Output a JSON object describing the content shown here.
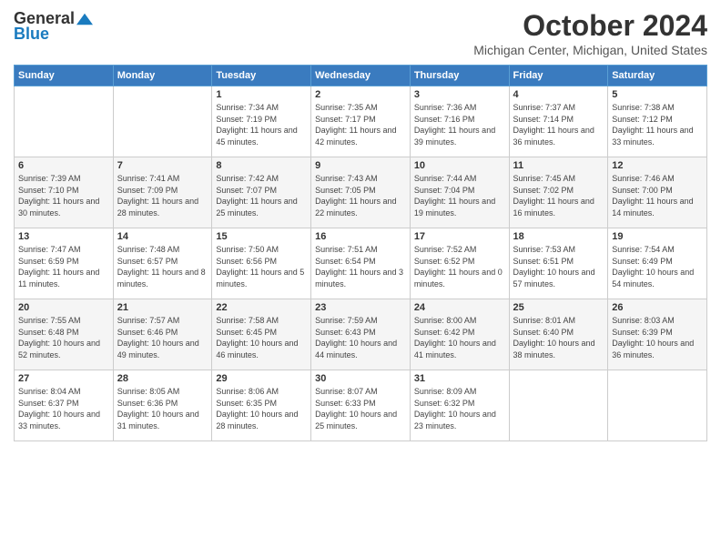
{
  "header": {
    "logo_general": "General",
    "logo_blue": "Blue",
    "month_title": "October 2024",
    "location": "Michigan Center, Michigan, United States"
  },
  "days_of_week": [
    "Sunday",
    "Monday",
    "Tuesday",
    "Wednesday",
    "Thursday",
    "Friday",
    "Saturday"
  ],
  "weeks": [
    [
      {
        "day": "",
        "sunrise": "",
        "sunset": "",
        "daylight": ""
      },
      {
        "day": "",
        "sunrise": "",
        "sunset": "",
        "daylight": ""
      },
      {
        "day": "1",
        "sunrise": "Sunrise: 7:34 AM",
        "sunset": "Sunset: 7:19 PM",
        "daylight": "Daylight: 11 hours and 45 minutes."
      },
      {
        "day": "2",
        "sunrise": "Sunrise: 7:35 AM",
        "sunset": "Sunset: 7:17 PM",
        "daylight": "Daylight: 11 hours and 42 minutes."
      },
      {
        "day": "3",
        "sunrise": "Sunrise: 7:36 AM",
        "sunset": "Sunset: 7:16 PM",
        "daylight": "Daylight: 11 hours and 39 minutes."
      },
      {
        "day": "4",
        "sunrise": "Sunrise: 7:37 AM",
        "sunset": "Sunset: 7:14 PM",
        "daylight": "Daylight: 11 hours and 36 minutes."
      },
      {
        "day": "5",
        "sunrise": "Sunrise: 7:38 AM",
        "sunset": "Sunset: 7:12 PM",
        "daylight": "Daylight: 11 hours and 33 minutes."
      }
    ],
    [
      {
        "day": "6",
        "sunrise": "Sunrise: 7:39 AM",
        "sunset": "Sunset: 7:10 PM",
        "daylight": "Daylight: 11 hours and 30 minutes."
      },
      {
        "day": "7",
        "sunrise": "Sunrise: 7:41 AM",
        "sunset": "Sunset: 7:09 PM",
        "daylight": "Daylight: 11 hours and 28 minutes."
      },
      {
        "day": "8",
        "sunrise": "Sunrise: 7:42 AM",
        "sunset": "Sunset: 7:07 PM",
        "daylight": "Daylight: 11 hours and 25 minutes."
      },
      {
        "day": "9",
        "sunrise": "Sunrise: 7:43 AM",
        "sunset": "Sunset: 7:05 PM",
        "daylight": "Daylight: 11 hours and 22 minutes."
      },
      {
        "day": "10",
        "sunrise": "Sunrise: 7:44 AM",
        "sunset": "Sunset: 7:04 PM",
        "daylight": "Daylight: 11 hours and 19 minutes."
      },
      {
        "day": "11",
        "sunrise": "Sunrise: 7:45 AM",
        "sunset": "Sunset: 7:02 PM",
        "daylight": "Daylight: 11 hours and 16 minutes."
      },
      {
        "day": "12",
        "sunrise": "Sunrise: 7:46 AM",
        "sunset": "Sunset: 7:00 PM",
        "daylight": "Daylight: 11 hours and 14 minutes."
      }
    ],
    [
      {
        "day": "13",
        "sunrise": "Sunrise: 7:47 AM",
        "sunset": "Sunset: 6:59 PM",
        "daylight": "Daylight: 11 hours and 11 minutes."
      },
      {
        "day": "14",
        "sunrise": "Sunrise: 7:48 AM",
        "sunset": "Sunset: 6:57 PM",
        "daylight": "Daylight: 11 hours and 8 minutes."
      },
      {
        "day": "15",
        "sunrise": "Sunrise: 7:50 AM",
        "sunset": "Sunset: 6:56 PM",
        "daylight": "Daylight: 11 hours and 5 minutes."
      },
      {
        "day": "16",
        "sunrise": "Sunrise: 7:51 AM",
        "sunset": "Sunset: 6:54 PM",
        "daylight": "Daylight: 11 hours and 3 minutes."
      },
      {
        "day": "17",
        "sunrise": "Sunrise: 7:52 AM",
        "sunset": "Sunset: 6:52 PM",
        "daylight": "Daylight: 11 hours and 0 minutes."
      },
      {
        "day": "18",
        "sunrise": "Sunrise: 7:53 AM",
        "sunset": "Sunset: 6:51 PM",
        "daylight": "Daylight: 10 hours and 57 minutes."
      },
      {
        "day": "19",
        "sunrise": "Sunrise: 7:54 AM",
        "sunset": "Sunset: 6:49 PM",
        "daylight": "Daylight: 10 hours and 54 minutes."
      }
    ],
    [
      {
        "day": "20",
        "sunrise": "Sunrise: 7:55 AM",
        "sunset": "Sunset: 6:48 PM",
        "daylight": "Daylight: 10 hours and 52 minutes."
      },
      {
        "day": "21",
        "sunrise": "Sunrise: 7:57 AM",
        "sunset": "Sunset: 6:46 PM",
        "daylight": "Daylight: 10 hours and 49 minutes."
      },
      {
        "day": "22",
        "sunrise": "Sunrise: 7:58 AM",
        "sunset": "Sunset: 6:45 PM",
        "daylight": "Daylight: 10 hours and 46 minutes."
      },
      {
        "day": "23",
        "sunrise": "Sunrise: 7:59 AM",
        "sunset": "Sunset: 6:43 PM",
        "daylight": "Daylight: 10 hours and 44 minutes."
      },
      {
        "day": "24",
        "sunrise": "Sunrise: 8:00 AM",
        "sunset": "Sunset: 6:42 PM",
        "daylight": "Daylight: 10 hours and 41 minutes."
      },
      {
        "day": "25",
        "sunrise": "Sunrise: 8:01 AM",
        "sunset": "Sunset: 6:40 PM",
        "daylight": "Daylight: 10 hours and 38 minutes."
      },
      {
        "day": "26",
        "sunrise": "Sunrise: 8:03 AM",
        "sunset": "Sunset: 6:39 PM",
        "daylight": "Daylight: 10 hours and 36 minutes."
      }
    ],
    [
      {
        "day": "27",
        "sunrise": "Sunrise: 8:04 AM",
        "sunset": "Sunset: 6:37 PM",
        "daylight": "Daylight: 10 hours and 33 minutes."
      },
      {
        "day": "28",
        "sunrise": "Sunrise: 8:05 AM",
        "sunset": "Sunset: 6:36 PM",
        "daylight": "Daylight: 10 hours and 31 minutes."
      },
      {
        "day": "29",
        "sunrise": "Sunrise: 8:06 AM",
        "sunset": "Sunset: 6:35 PM",
        "daylight": "Daylight: 10 hours and 28 minutes."
      },
      {
        "day": "30",
        "sunrise": "Sunrise: 8:07 AM",
        "sunset": "Sunset: 6:33 PM",
        "daylight": "Daylight: 10 hours and 25 minutes."
      },
      {
        "day": "31",
        "sunrise": "Sunrise: 8:09 AM",
        "sunset": "Sunset: 6:32 PM",
        "daylight": "Daylight: 10 hours and 23 minutes."
      },
      {
        "day": "",
        "sunrise": "",
        "sunset": "",
        "daylight": ""
      },
      {
        "day": "",
        "sunrise": "",
        "sunset": "",
        "daylight": ""
      }
    ]
  ]
}
